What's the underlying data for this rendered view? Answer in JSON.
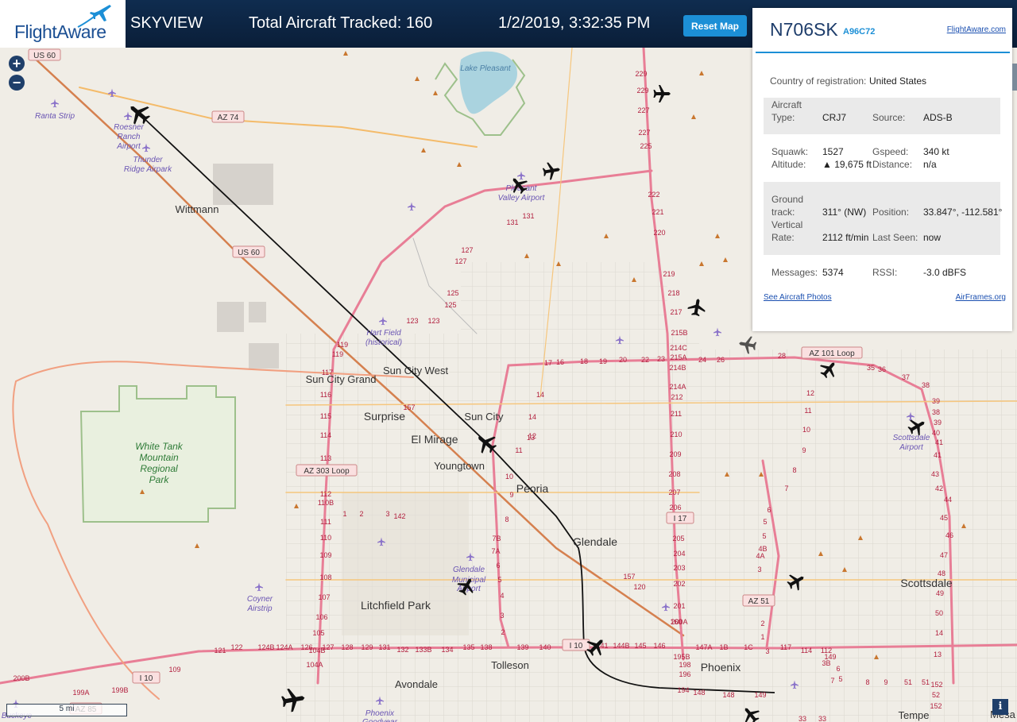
{
  "header": {
    "logo_text": "FlightAware",
    "app_name": "SKYVIEW",
    "tracked": "Total Aircraft Tracked: 160",
    "clock": "1/2/2019, 3:32:35 PM",
    "reset_label": "Reset Map"
  },
  "map": {
    "zoom_in": "+",
    "zoom_out": "−",
    "scale": "5 mi",
    "info": "i",
    "places": [
      {
        "t": "Wittmann"
      },
      {
        "t": "Sun City Grand"
      },
      {
        "t": "Sun City West"
      },
      {
        "t": "Surprise"
      },
      {
        "t": "El Mirage"
      },
      {
        "t": "Sun City"
      },
      {
        "t": "Youngtown"
      },
      {
        "t": "Peoria"
      },
      {
        "t": "Glendale"
      },
      {
        "t": "Litchfield Park"
      },
      {
        "t": "Tolleson"
      },
      {
        "t": "Avondale"
      },
      {
        "t": "Phoenix"
      },
      {
        "t": "Scottsdale"
      },
      {
        "t": "Tempe"
      },
      {
        "t": "Mesa"
      }
    ],
    "green_labels": [
      {
        "t": "White Tank"
      },
      {
        "t": "Mountain"
      },
      {
        "t": "Regional"
      },
      {
        "t": "Park"
      }
    ],
    "airports": [
      {
        "t": "Ranta Strip"
      },
      {
        "t": "Roesner"
      },
      {
        "t": "Ranch"
      },
      {
        "t": "Airport"
      },
      {
        "t": "Thunder"
      },
      {
        "t": "Ridge Airpark"
      },
      {
        "t": "Pleasant"
      },
      {
        "t": "Valley Airport"
      },
      {
        "t": "Hart Field"
      },
      {
        "t": "(historical)"
      },
      {
        "t": "Glendale"
      },
      {
        "t": "Municipal"
      },
      {
        "t": "Airport"
      },
      {
        "t": "Coyner"
      },
      {
        "t": "Airstrip"
      },
      {
        "t": "Scottsdale"
      },
      {
        "t": "Airport"
      },
      {
        "t": "Phoenix"
      },
      {
        "t": "Goodyear"
      },
      {
        "t": "Buckeye"
      }
    ],
    "lake": "Lake Pleasant",
    "shields": [
      {
        "t": "US 60"
      },
      {
        "t": "AZ 74"
      },
      {
        "t": "US 60"
      },
      {
        "t": "AZ 303 Loop"
      },
      {
        "t": "AZ 101 Loop"
      },
      {
        "t": "I 17"
      },
      {
        "t": "AZ 51"
      },
      {
        "t": "I 10"
      },
      {
        "t": "I 10"
      },
      {
        "t": "AZ 85"
      }
    ],
    "exits": [
      {
        "t": "229"
      },
      {
        "t": "229"
      },
      {
        "t": "227"
      },
      {
        "t": "227"
      },
      {
        "t": "225"
      },
      {
        "t": "222"
      },
      {
        "t": "221"
      },
      {
        "t": "220"
      },
      {
        "t": "219"
      },
      {
        "t": "218"
      },
      {
        "t": "217"
      },
      {
        "t": "215B"
      },
      {
        "t": "214C"
      },
      {
        "t": "215A"
      },
      {
        "t": "214B"
      },
      {
        "t": "214A"
      },
      {
        "t": "212"
      },
      {
        "t": "211"
      },
      {
        "t": "210"
      },
      {
        "t": "209"
      },
      {
        "t": "208"
      },
      {
        "t": "207"
      },
      {
        "t": "206"
      },
      {
        "t": "205"
      },
      {
        "t": "204"
      },
      {
        "t": "203"
      },
      {
        "t": "202"
      },
      {
        "t": "201"
      },
      {
        "t": "200A"
      },
      {
        "t": "160"
      },
      {
        "t": "131"
      },
      {
        "t": "131"
      },
      {
        "t": "127"
      },
      {
        "t": "127"
      },
      {
        "t": "125"
      },
      {
        "t": "125"
      },
      {
        "t": "123"
      },
      {
        "t": "123"
      },
      {
        "t": "119"
      },
      {
        "t": "119"
      },
      {
        "t": "117"
      },
      {
        "t": "116"
      },
      {
        "t": "115"
      },
      {
        "t": "114"
      },
      {
        "t": "113"
      },
      {
        "t": "112"
      },
      {
        "t": "110B"
      },
      {
        "t": "111"
      },
      {
        "t": "110"
      },
      {
        "t": "109"
      },
      {
        "t": "108"
      },
      {
        "t": "107"
      },
      {
        "t": "106"
      },
      {
        "t": "105"
      },
      {
        "t": "104B"
      },
      {
        "t": "104A"
      },
      {
        "t": "17"
      },
      {
        "t": "16"
      },
      {
        "t": "18"
      },
      {
        "t": "19"
      },
      {
        "t": "20"
      },
      {
        "t": "22"
      },
      {
        "t": "23"
      },
      {
        "t": "24"
      },
      {
        "t": "26"
      },
      {
        "t": "28"
      },
      {
        "t": "14"
      },
      {
        "t": "14"
      },
      {
        "t": "13"
      },
      {
        "t": "12"
      },
      {
        "t": "11"
      },
      {
        "t": "10"
      },
      {
        "t": "9"
      },
      {
        "t": "8"
      },
      {
        "t": "7B"
      },
      {
        "t": "7A"
      },
      {
        "t": "6"
      },
      {
        "t": "5"
      },
      {
        "t": "4"
      },
      {
        "t": "3"
      },
      {
        "t": "2"
      },
      {
        "t": "1"
      },
      {
        "t": "2"
      },
      {
        "t": "3"
      },
      {
        "t": "142"
      },
      {
        "t": "157"
      },
      {
        "t": "157"
      },
      {
        "t": "120"
      },
      {
        "t": "121"
      },
      {
        "t": "122"
      },
      {
        "t": "124B"
      },
      {
        "t": "124A"
      },
      {
        "t": "126"
      },
      {
        "t": "127"
      },
      {
        "t": "128"
      },
      {
        "t": "129"
      },
      {
        "t": "131"
      },
      {
        "t": "132"
      },
      {
        "t": "133B"
      },
      {
        "t": "134"
      },
      {
        "t": "135"
      },
      {
        "t": "138"
      },
      {
        "t": "139"
      },
      {
        "t": "140"
      },
      {
        "t": "141"
      },
      {
        "t": "144B"
      },
      {
        "t": "145"
      },
      {
        "t": "146"
      },
      {
        "t": "147A"
      },
      {
        "t": "1B"
      },
      {
        "t": "1C"
      },
      {
        "t": "3"
      },
      {
        "t": "117"
      },
      {
        "t": "114"
      },
      {
        "t": "112"
      },
      {
        "t": "109"
      },
      {
        "t": "199B"
      },
      {
        "t": "199A"
      },
      {
        "t": "200B"
      },
      {
        "t": "198"
      },
      {
        "t": "196"
      },
      {
        "t": "195B"
      },
      {
        "t": "194"
      },
      {
        "t": "148"
      },
      {
        "t": "148"
      },
      {
        "t": "149"
      },
      {
        "t": "149"
      },
      {
        "t": "3B"
      },
      {
        "t": "6"
      },
      {
        "t": "5"
      },
      {
        "t": "7"
      },
      {
        "t": "8"
      },
      {
        "t": "9"
      },
      {
        "t": "51"
      },
      {
        "t": "51"
      },
      {
        "t": "52"
      },
      {
        "t": "152"
      },
      {
        "t": "152"
      },
      {
        "t": "33"
      },
      {
        "t": "33"
      },
      {
        "t": "35"
      },
      {
        "t": "36"
      },
      {
        "t": "37"
      },
      {
        "t": "38"
      },
      {
        "t": "39"
      },
      {
        "t": "38"
      },
      {
        "t": "39"
      },
      {
        "t": "40"
      },
      {
        "t": "41"
      },
      {
        "t": "41"
      },
      {
        "t": "42"
      },
      {
        "t": "43"
      },
      {
        "t": "44"
      },
      {
        "t": "45"
      },
      {
        "t": "46"
      },
      {
        "t": "47"
      },
      {
        "t": "48"
      },
      {
        "t": "49"
      },
      {
        "t": "50"
      },
      {
        "t": "14"
      },
      {
        "t": "13"
      },
      {
        "t": "12"
      },
      {
        "t": "11"
      },
      {
        "t": "10"
      },
      {
        "t": "9"
      },
      {
        "t": "8"
      },
      {
        "t": "7"
      },
      {
        "t": "6"
      },
      {
        "t": "5"
      },
      {
        "t": "5"
      },
      {
        "t": "4B"
      },
      {
        "t": "4A"
      },
      {
        "t": "3"
      },
      {
        "t": "2"
      },
      {
        "t": "1"
      }
    ]
  },
  "panel": {
    "registration": "N706SK",
    "hex": "A96C72",
    "site_link": "FlightAware.com",
    "country_label": "Country of registration:",
    "country_value": "United States",
    "aircraft_label_1": "Aircraft",
    "aircraft_label_2": "Type:",
    "aircraft_value": "CRJ7",
    "source_label": "Source:",
    "source_value": "ADS-B",
    "squawk_label": "Squawk:",
    "squawk_value": "1527",
    "altitude_label": "Altitude:",
    "altitude_value": "▲ 19,675 ft",
    "gspeed_label": "Gspeed:",
    "gspeed_value": "340 kt",
    "distance_label": "Distance:",
    "distance_value": "n/a",
    "track_label_1": "Ground",
    "track_label_2": "track:",
    "track_value": "311° (NW)",
    "position_label": "Position:",
    "position_value": "33.847°, -112.581°",
    "vrate_label_1": "Vertical",
    "vrate_label_2": "Rate:",
    "vrate_value": "2112 ft/min",
    "lastseen_label": "Last Seen:",
    "lastseen_value": "now",
    "messages_label": "Messages:",
    "messages_value": "5374",
    "rssi_label": "RSSI:",
    "rssi_value": "-3.0 dBFS",
    "photos_link": "See Aircraft Photos",
    "airframes_link": "AirFrames.org"
  }
}
